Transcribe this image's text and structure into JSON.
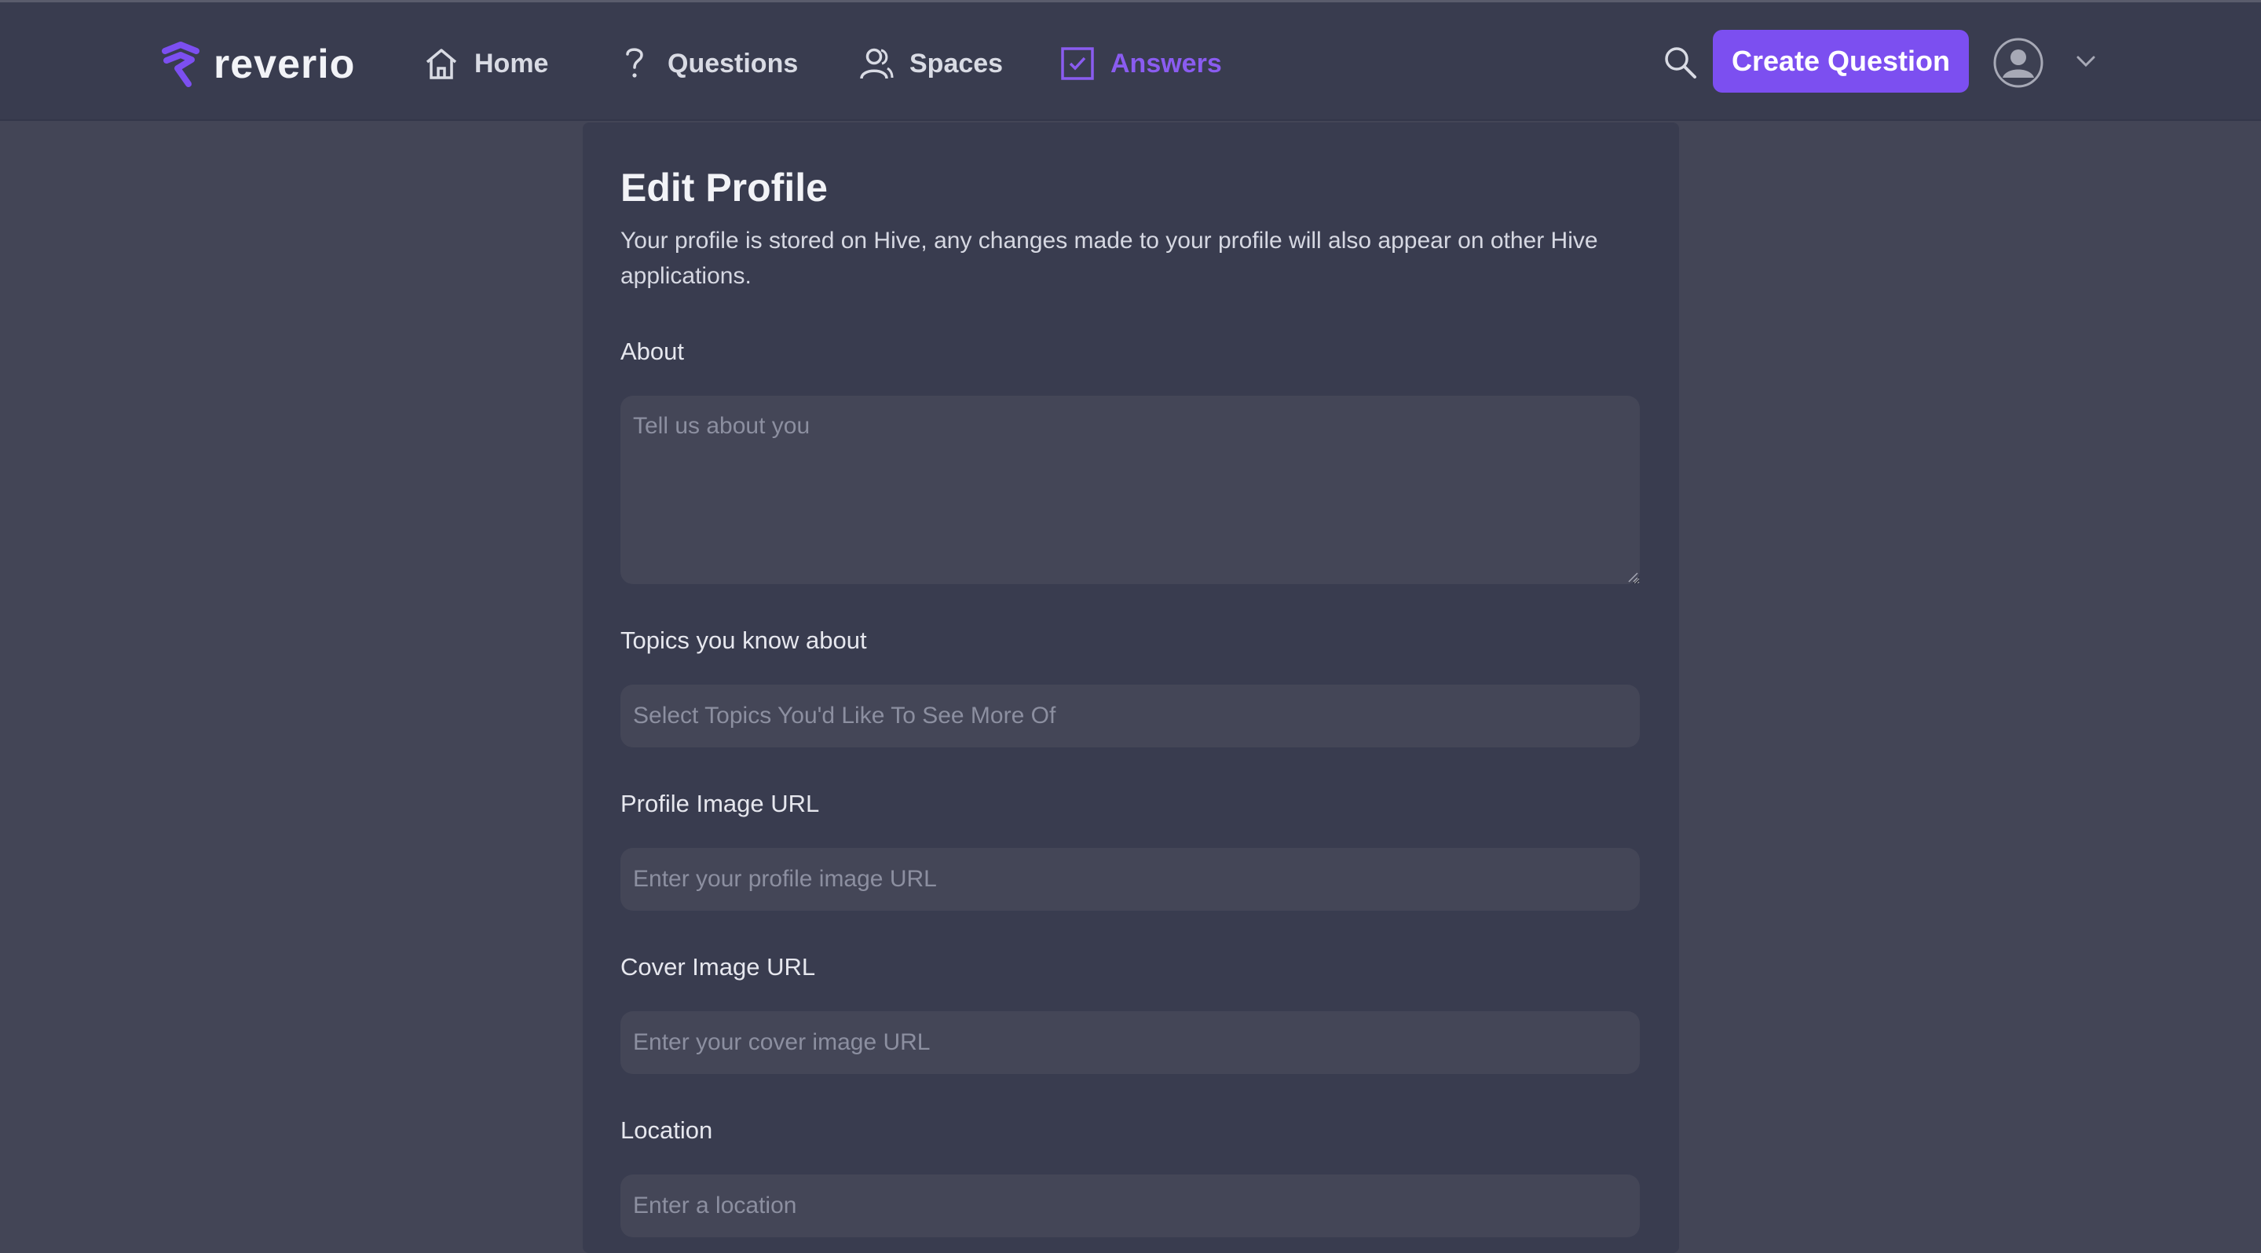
{
  "header": {
    "brand": "reverio",
    "nav": [
      {
        "label": "Home",
        "icon": "home-icon"
      },
      {
        "label": "Questions",
        "icon": "question-icon"
      },
      {
        "label": "Spaces",
        "icon": "spaces-icon"
      },
      {
        "label": "Answers",
        "icon": "checkbox-icon",
        "active": true
      }
    ],
    "create_label": "Create Question",
    "accent": "#7c4ff0"
  },
  "form": {
    "title": "Edit Profile",
    "description": "Your profile is stored on Hive, any changes made to your profile will also appear on other Hive applications.",
    "about": {
      "label": "About",
      "placeholder": "Tell us about you",
      "value": ""
    },
    "topics": {
      "label": "Topics you know about",
      "placeholder": "Select Topics You'd Like To See More Of",
      "value": ""
    },
    "profile_image": {
      "label": "Profile Image URL",
      "placeholder": "Enter your profile image URL",
      "value": ""
    },
    "cover_image": {
      "label": "Cover Image URL",
      "placeholder": "Enter your cover image URL",
      "value": ""
    },
    "location": {
      "label": "Location",
      "placeholder": "Enter a location",
      "value": ""
    }
  }
}
